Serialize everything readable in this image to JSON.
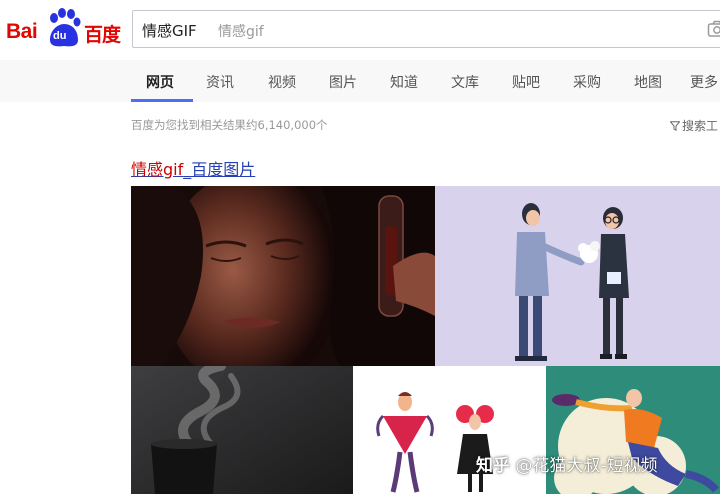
{
  "logo": {
    "left_text": "Bai",
    "paw_text": "du",
    "right_text": "百度"
  },
  "search": {
    "query": "情感GIF",
    "suggestion": "情感gif"
  },
  "tabs": [
    {
      "label": "网页",
      "active": true
    },
    {
      "label": "资讯"
    },
    {
      "label": "视频"
    },
    {
      "label": "图片"
    },
    {
      "label": "知道"
    },
    {
      "label": "文库"
    },
    {
      "label": "贴吧"
    },
    {
      "label": "采购"
    },
    {
      "label": "地图"
    },
    {
      "label": "更多"
    }
  ],
  "results": {
    "count_text": "百度为您找到相关结果约6,140,000个",
    "tools_label": "搜索工",
    "first": {
      "title_highlight": "情感gif",
      "title_rest": "_百度图片"
    }
  },
  "watermark": {
    "logo": "知乎",
    "text": "@花猫大叔-短视频"
  },
  "colors": {
    "brand_red": "#e10601",
    "brand_blue": "#2932e1",
    "link": "#2440b3",
    "tab_accent": "#4e6ef2"
  },
  "icons": [
    "camera-icon",
    "filter-icon",
    "baidu-paw-icon"
  ]
}
